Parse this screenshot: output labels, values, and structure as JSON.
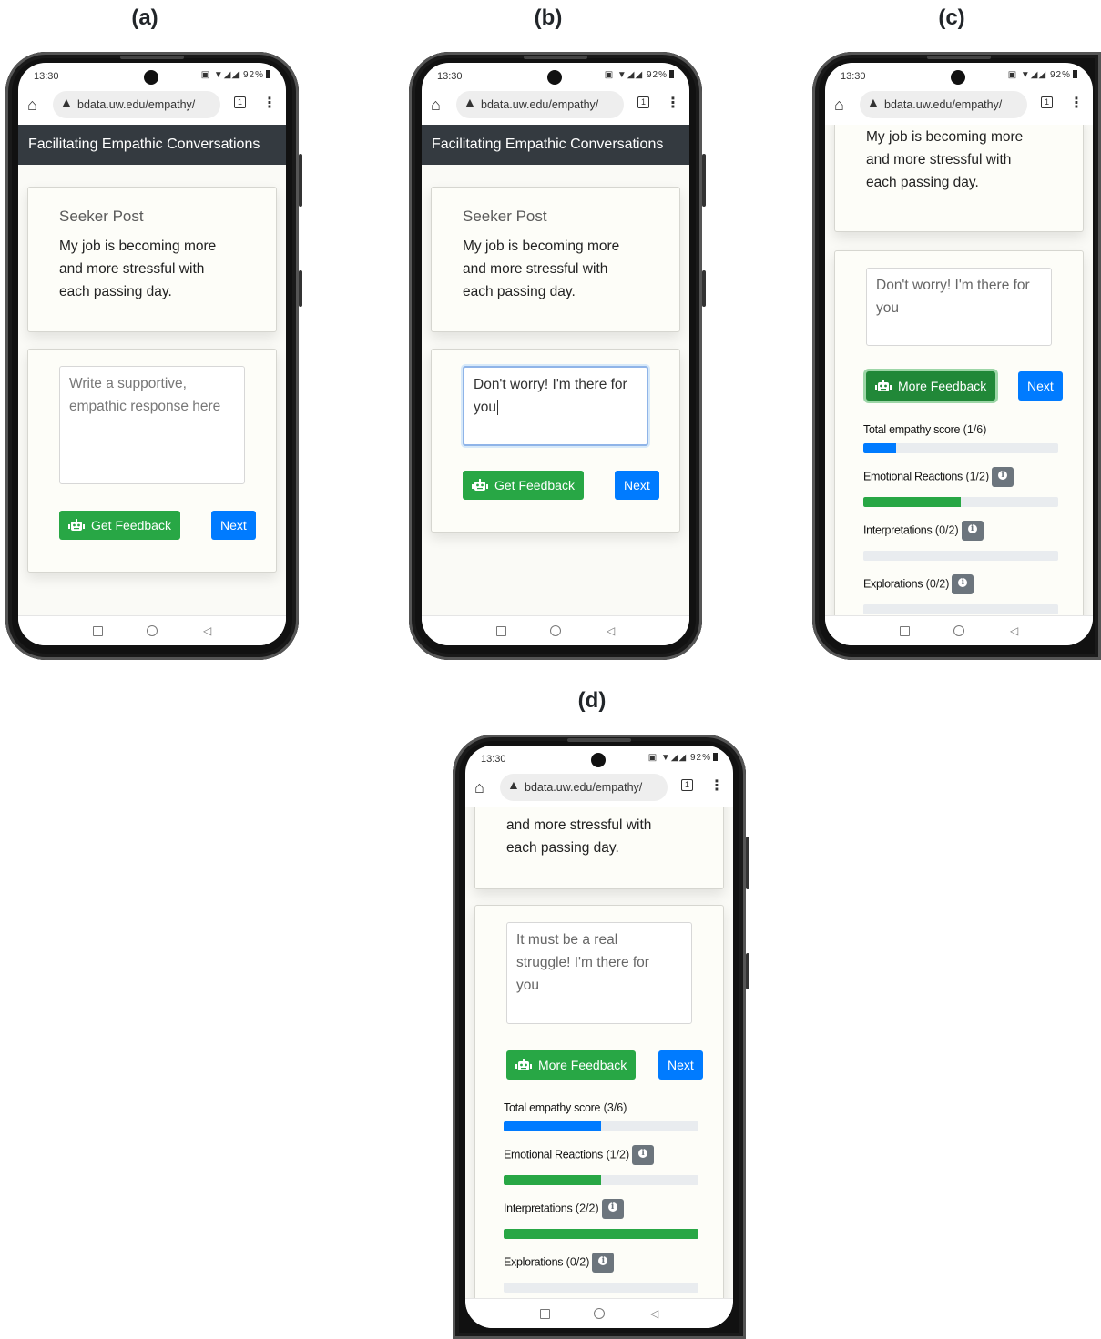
{
  "labels": {
    "a": "(a)",
    "b": "(b)",
    "c": "(c)",
    "d": "(d)"
  },
  "status": {
    "time": "13:30",
    "battery": "92%"
  },
  "browser": {
    "url": "bdata.uw.edu/empathy/",
    "tab_count": "1"
  },
  "app": {
    "title": "Facilitating Empathic Conversations"
  },
  "seeker": {
    "title": "Seeker Post",
    "line1": "My job is becoming more",
    "line2": "and more stressful with",
    "line3": "each passing day."
  },
  "response": {
    "placeholder_line1": "Write a supportive,",
    "placeholder_line2": "empathic response here",
    "draft_line1": "Don't worry! I'm there for",
    "draft_line2": "you",
    "revised_line1": "It must be a real",
    "revised_line2": "struggle! I'm there for",
    "revised_line3": "you"
  },
  "buttons": {
    "get_feedback": "Get Feedback",
    "more_feedback": "More Feedback",
    "next": "Next"
  },
  "scores_c": {
    "total": {
      "label": "Total empathy score",
      "value": "(1/6)",
      "fraction": 0.1667
    },
    "emotional": {
      "label": "Emotional Reactions",
      "value": "(1/2)",
      "fraction": 0.5
    },
    "interpretations": {
      "label": "Interpretations",
      "value": "(0/2)",
      "fraction": 0
    },
    "explorations": {
      "label": "Explorations",
      "value": "(0/2)",
      "fraction": 0
    }
  },
  "scores_d": {
    "total": {
      "label": "Total empathy score",
      "value": "(3/6)",
      "fraction": 0.5
    },
    "emotional": {
      "label": "Emotional Reactions",
      "value": "(1/2)",
      "fraction": 0.5
    },
    "interpretations": {
      "label": "Interpretations",
      "value": "(2/2)",
      "fraction": 1
    },
    "explorations": {
      "label": "Explorations",
      "value": "(0/2)",
      "fraction": 0
    }
  },
  "colors": {
    "primary": "#007bff",
    "success": "#28a745",
    "navbar": "#343a40",
    "info_badge": "#6c757d"
  }
}
